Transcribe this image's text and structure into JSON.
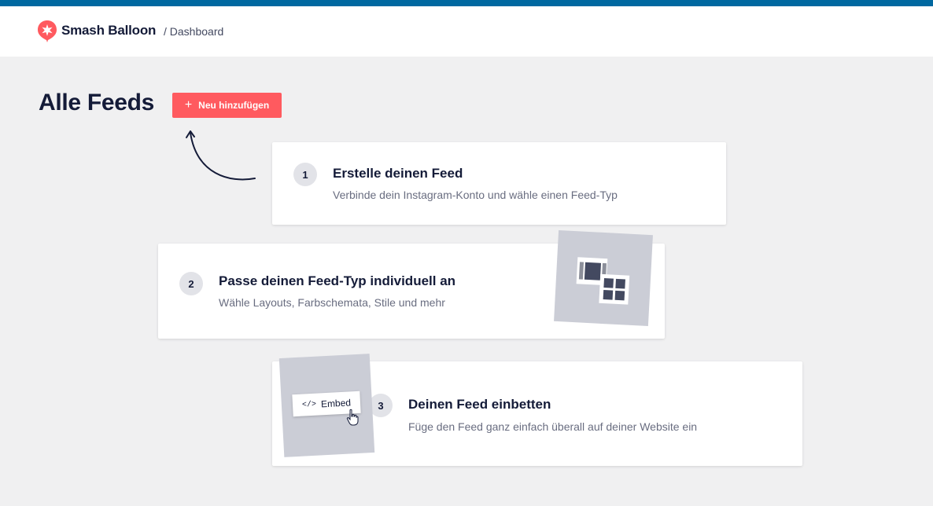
{
  "header": {
    "brand": "Smash Balloon",
    "breadcrumb": "/ Dashboard"
  },
  "main": {
    "title": "Alle Feeds",
    "add_button_label": "Neu hinzufügen"
  },
  "steps": [
    {
      "number": "1",
      "title": "Erstelle deinen Feed",
      "description": "Verbinde dein Instagram-Konto und wähle einen Feed-Typ"
    },
    {
      "number": "2",
      "title": "Passe deinen Feed-Typ individuell an",
      "description": "Wähle Layouts, Farbschemata, Stile und mehr"
    },
    {
      "number": "3",
      "title": "Deinen Feed einbetten",
      "description": "Füge den Feed ganz einfach überall auf deiner Website ein",
      "embed_label": "Embed",
      "embed_code_glyph": "</>"
    }
  ],
  "colors": {
    "accent_top_bar": "#0068a0",
    "add_button": "#ff5a5f",
    "brand_logo": "#ff5a5f"
  }
}
